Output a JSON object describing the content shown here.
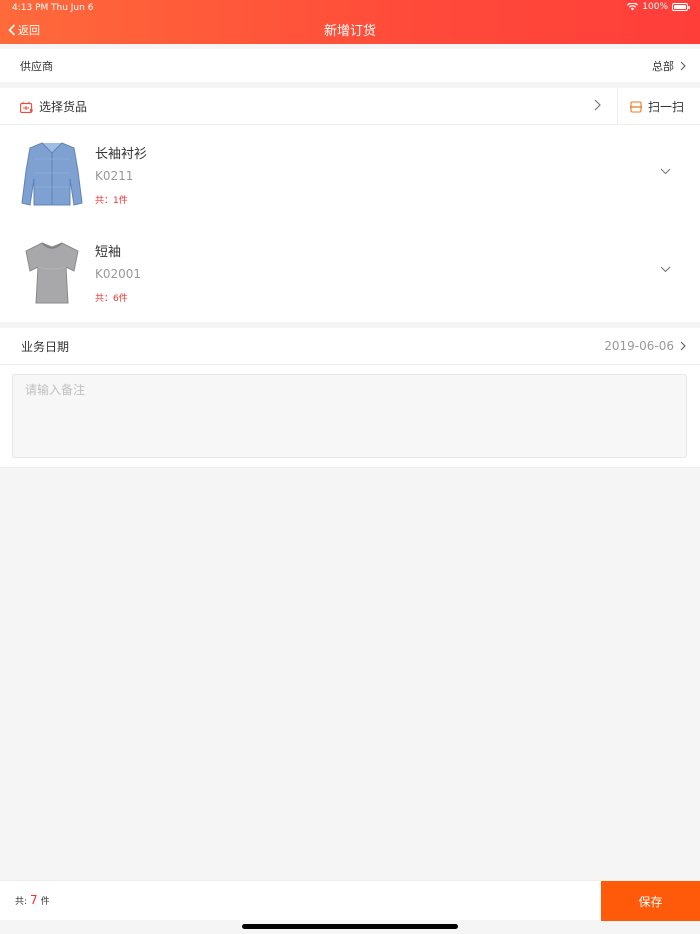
{
  "status_bar": {
    "time": "4:13 PM",
    "date": "Thu Jun 6",
    "battery": "100%"
  },
  "nav": {
    "back_label": "返回",
    "title": "新增订货"
  },
  "supplier": {
    "label": "供应商",
    "value": "总部"
  },
  "select_goods": {
    "label": "选择货品",
    "scan_label": "扫一扫"
  },
  "goods": [
    {
      "name": "长袖衬衫",
      "code": "K0211",
      "count": "共：1件",
      "icon": "long-sleeve-shirt"
    },
    {
      "name": "短袖",
      "code": "K02001",
      "count": "共：6件",
      "icon": "short-sleeve-tshirt"
    }
  ],
  "business_date": {
    "label": "业务日期",
    "value": "2019-06-06"
  },
  "remark": {
    "placeholder": "请输入备注",
    "value": ""
  },
  "footer": {
    "total_prefix": "共:",
    "total_count": "7",
    "total_unit": "件",
    "save_label": "保存"
  },
  "colors": {
    "accent": "#ff4a3a",
    "save_button": "#ff5a0a",
    "count_red": "#f23030"
  }
}
